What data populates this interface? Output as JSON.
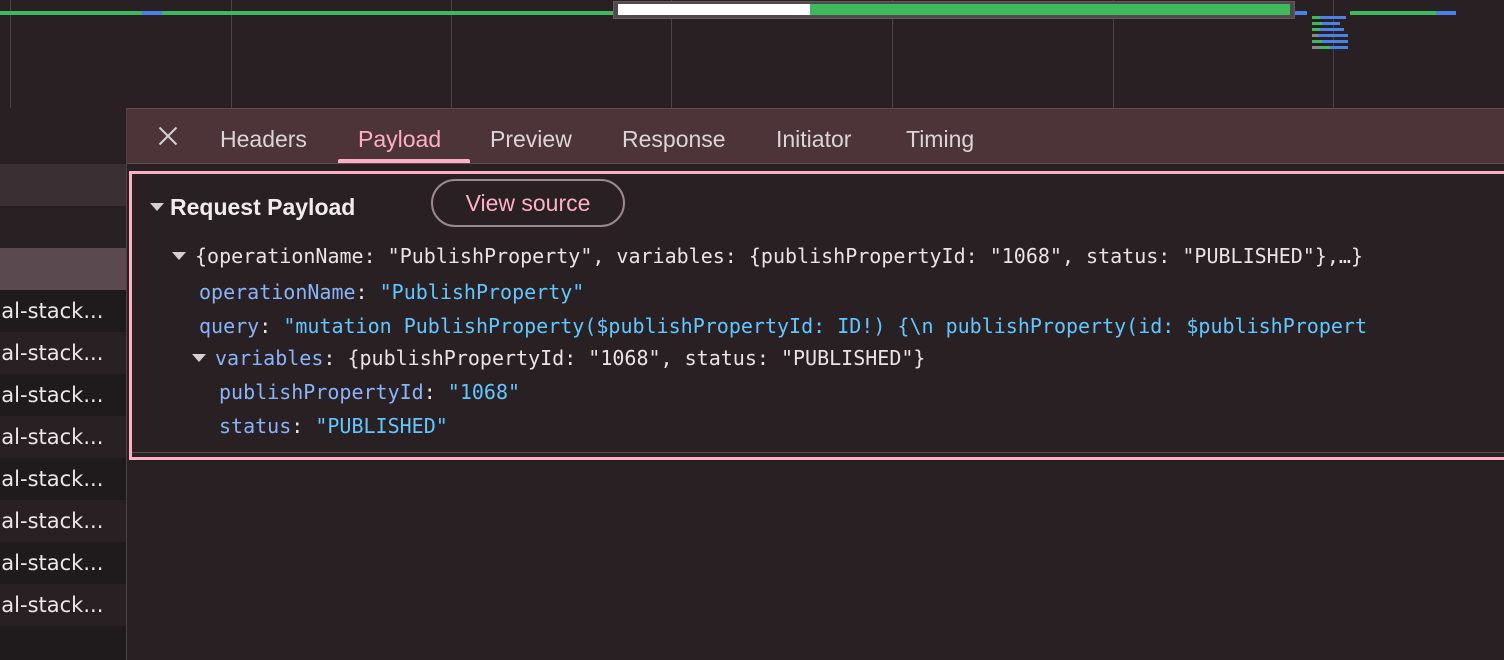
{
  "request_list": {
    "rows": [
      "nal-stack...",
      "nal-stack...",
      "nal-stack...",
      "nal-stack...",
      "nal-stack...",
      "nal-stack...",
      "nal-stack...",
      "nal-stack..."
    ]
  },
  "tabs": [
    {
      "label": "Headers"
    },
    {
      "label": "Payload"
    },
    {
      "label": "Preview"
    },
    {
      "label": "Response"
    },
    {
      "label": "Initiator"
    },
    {
      "label": "Timing"
    }
  ],
  "active_tab": "Payload",
  "payload": {
    "section_title": "Request Payload",
    "view_source_label": "View source",
    "summary": "{operationName: \"PublishProperty\", variables: {publishPropertyId: \"1068\", status: \"PUBLISHED\"},…}",
    "operationName_key": "operationName",
    "operationName_value": "\"PublishProperty\"",
    "query_key": "query",
    "query_value": "\"mutation PublishProperty($publishPropertyId: ID!) {\\n  publishProperty(id: $publishPropert",
    "variables_key": "variables",
    "variables_summary": "{publishPropertyId: \"1068\", status: \"PUBLISHED\"}",
    "publishPropertyId_key": "publishPropertyId",
    "publishPropertyId_value": "\"1068\"",
    "status_key": "status",
    "status_value": "\"PUBLISHED\"",
    "separator": ":"
  },
  "colors": {
    "accent": "#ffb0c5",
    "key": "#8ab4f8",
    "string": "#62c7ff",
    "tabbar_bg": "#4c3439",
    "panel_bg": "#292024",
    "bar_green": "#3dbb5c",
    "bar_blue": "#4a82e8"
  },
  "icons": {
    "close": "close-icon",
    "expand": "triangle-down-icon"
  }
}
